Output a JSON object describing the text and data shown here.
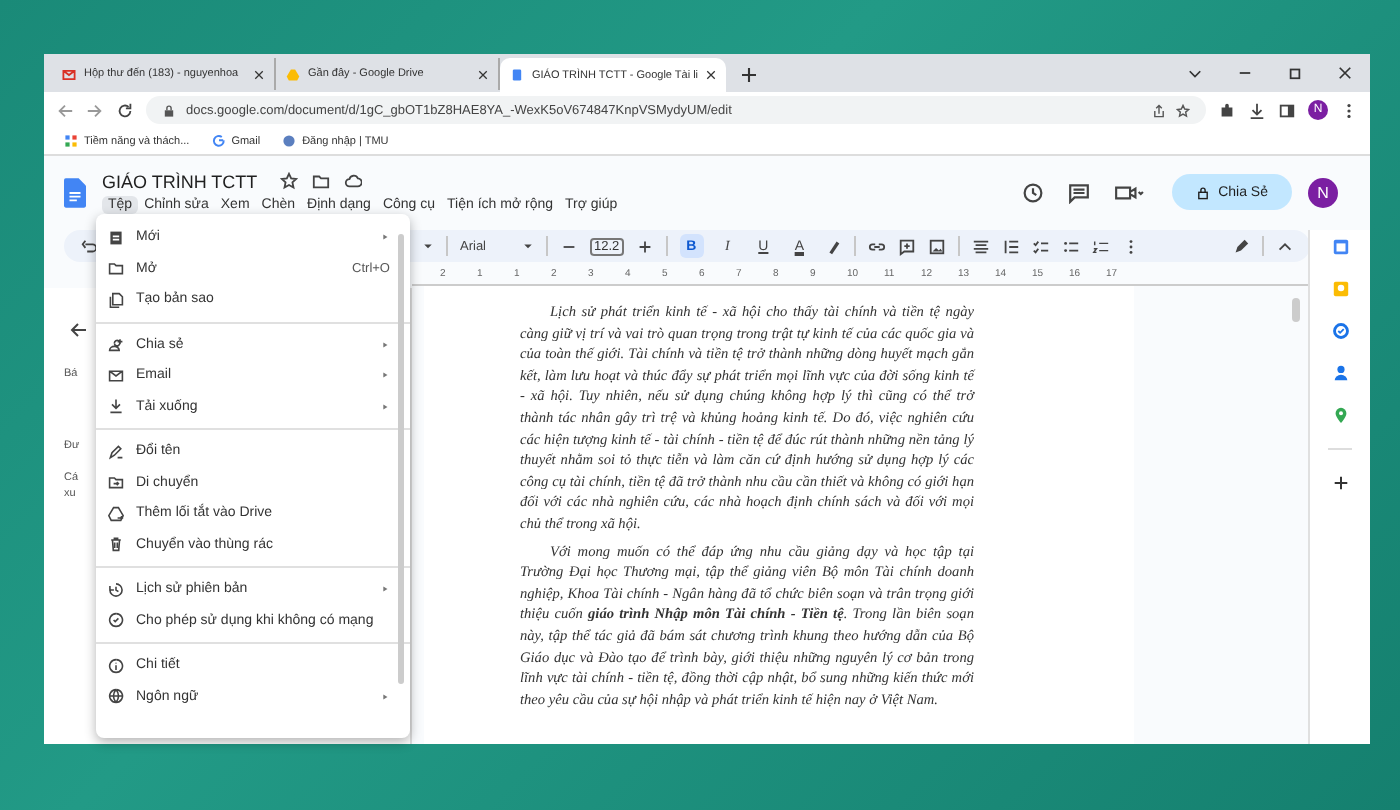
{
  "browser": {
    "tabs": [
      {
        "title": "Hộp thư đến (183) - nguyenhoa",
        "selected": false
      },
      {
        "title": "Gần đây - Google Drive",
        "selected": false
      },
      {
        "title": "GIÁO TRÌNH TCTT - Google Tài li",
        "selected": true
      }
    ],
    "url": "docs.google.com/document/d/1gC_gbOT1bZ8HAE8YA_-WexK5oV674847KnpVSMydyUM/edit",
    "profile_initial": "N",
    "bookmarks": [
      "Tiềm năng và thách...",
      "Gmail",
      "Đăng nhập | TMU"
    ]
  },
  "doc": {
    "title": "GIÁO TRÌNH TCTT",
    "menu": [
      {
        "label": "Tệp",
        "selected": true
      },
      {
        "label": "Chỉnh sửa",
        "selected": false
      },
      {
        "label": "Xem",
        "selected": false
      },
      {
        "label": "Chèn",
        "selected": false
      },
      {
        "label": "Định dạng",
        "selected": false
      },
      {
        "label": "Công cụ",
        "selected": false
      },
      {
        "label": "Tiện ích mở rộng",
        "selected": false
      },
      {
        "label": "Trợ giúp",
        "selected": false
      }
    ],
    "share_label": "Chia Sẻ",
    "user_initial": "N"
  },
  "toolbar": {
    "font": "Arial",
    "font_size": "12.2",
    "format": [
      {
        "label": "B",
        "selected": true
      },
      {
        "label": "I",
        "selected": false
      },
      {
        "label": "U",
        "selected": false
      },
      {
        "label": "A",
        "selected": false
      }
    ]
  },
  "ruler": [
    "2",
    "1",
    "1",
    "2",
    "3",
    "4",
    "5",
    "6",
    "7",
    "8",
    "9",
    "10",
    "11",
    "12",
    "13",
    "14",
    "15",
    "16",
    "17"
  ],
  "outline": [
    "Bá",
    "Đư",
    "Cá",
    "xu"
  ],
  "file_menu": [
    [
      {
        "label": "Mới",
        "submenu": true
      },
      {
        "label": "Mở",
        "shortcut": "Ctrl+O",
        "submenu": false
      },
      {
        "label": "Tạo bản sao",
        "submenu": false
      }
    ],
    [
      {
        "label": "Chia sẻ",
        "submenu": true
      },
      {
        "label": "Email",
        "submenu": true
      },
      {
        "label": "Tải xuống",
        "submenu": true
      }
    ],
    [
      {
        "label": "Đổi tên",
        "submenu": false
      },
      {
        "label": "Di chuyển",
        "submenu": false
      },
      {
        "label": "Thêm lối tắt vào Drive",
        "submenu": false
      },
      {
        "label": "Chuyển vào thùng rác",
        "submenu": false
      }
    ],
    [
      {
        "label": "Lịch sử phiên bản",
        "submenu": true
      },
      {
        "label": "Cho phép sử dụng khi không có mạng",
        "submenu": false
      }
    ],
    [
      {
        "label": "Chi tiết",
        "submenu": false
      },
      {
        "label": "Ngôn ngữ",
        "submenu": true
      }
    ]
  ],
  "paragraphs": [
    "Lịch sử phát triển kinh tế - xã hội cho thấy tài chính và tiền tệ ngày càng giữ vị trí và vai trò quan trọng trong trật tự kinh tế của các quốc gia và của toàn thế giới. Tài chính và tiền tệ trở thành những dòng huyết mạch gắn kết, làm lưu hoạt và thúc đẩy sự phát triển mọi lĩnh vực của đời sống kinh tế - xã hội. Tuy nhiên, nếu sử dụng chúng không hợp lý thì cũng có thể trở thành tác nhân gây trì trệ và khủng hoảng kinh tế. Do đó, việc nghiên cứu các hiện tượng kinh tế - tài chính - tiền tệ để đúc rút thành những nền tảng lý thuyết nhằm soi tỏ thực tiễn và làm căn cứ định hướng sử dụng hợp lý các công cụ tài chính, tiền tệ đã trở thành nhu cầu cần thiết và không có giới hạn đối với các nhà nghiên cứu, các nhà hoạch định chính sách và đối với mọi chủ thể trong xã hội.",
    "Với mong muốn có thể đáp ứng nhu cầu giảng dạy và học tập tại Trường Đại học Thương mại, tập thể giảng viên Bộ môn Tài chính doanh nghiệp, Khoa Tài chính - Ngân hàng đã tổ chức biên soạn và trân trọng giới thiệu cuốn **giáo trình Nhập môn Tài chính - Tiền tệ**. Trong lần biên soạn này, tập thể tác giả đã bám sát chương trình khung theo hướng dẫn của Bộ Giáo dục và Đào tạo để trình bày, giới thiệu những nguyên lý cơ bản trong lĩnh vực tài chính - tiền tệ, đồng thời cập nhật, bổ sung những kiến thức mới theo yêu cầu của sự hội nhập và phát triển kinh tế hiện nay ở Việt Nam."
  ]
}
